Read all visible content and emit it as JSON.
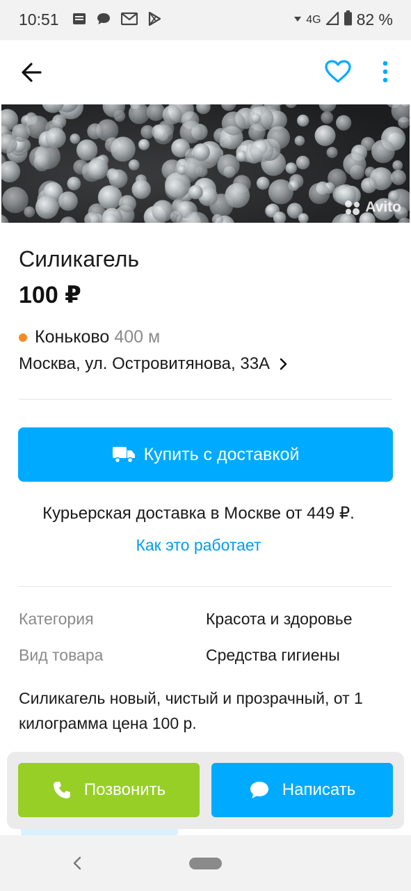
{
  "status_bar": {
    "time": "10:51",
    "network": "4G",
    "battery": "82 %",
    "icons": [
      "news-icon",
      "chat-icon",
      "mail-icon",
      "play-store-icon",
      "wifi-icon",
      "signal-icon",
      "battery-icon"
    ]
  },
  "app_bar": {
    "icons": [
      "arrow-left-icon",
      "heart-outline-icon",
      "more-vertical-icon"
    ],
    "accent_color": "#00aaff"
  },
  "photo": {
    "watermark": "Avito"
  },
  "listing": {
    "title": "Силикагель",
    "price": "100 ₽",
    "metro_station": "Коньково",
    "metro_distance": "400 м",
    "metro_color": "#f68b26",
    "address": "Москва, ул. Островитянова, 33А"
  },
  "delivery": {
    "buy_label": "Купить с доставкой",
    "note": "Курьерская доставка в Москве от 449 ₽.",
    "how_link": "Как это работает"
  },
  "params": [
    {
      "label": "Категория",
      "value": "Красота и здоровье"
    },
    {
      "label": "Вид товара",
      "value": "Средства гигиены"
    }
  ],
  "description": "Силикагель новый, чистый и прозрачный, от 1 килограмма цена 100 р.",
  "actions": {
    "call_label": "Позвонить",
    "call_color": "#97cf26",
    "message_label": "Написать",
    "message_color": "#00aaff"
  }
}
